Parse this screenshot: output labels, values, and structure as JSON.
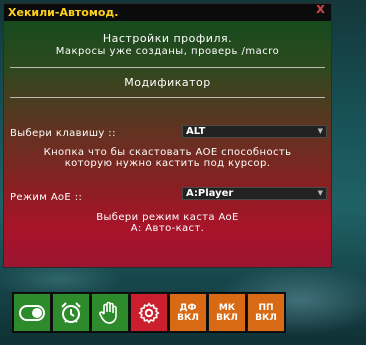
{
  "window": {
    "title": "Хекили-Автомод.",
    "close_glyph": "x"
  },
  "header": {
    "line1": "Настройки профиля.",
    "line2": "Макросы уже созданы, проверь /macro"
  },
  "section": {
    "title": "Модификатор"
  },
  "key_setting": {
    "label": "Выбери клавишу ::",
    "value": "ALT",
    "desc_line1": "Кнопка что бы скастовать AOE способность",
    "desc_line2": "которую нужно кастить под курсор."
  },
  "aoe_setting": {
    "label": "Режим AoE ::",
    "value": "A:Player",
    "desc_line1": "Выбери режим каста AoE",
    "desc_line2": "А: Авто-каст."
  },
  "toolbar": {
    "buttons": [
      {
        "icon": "toggle-icon",
        "color": "#2e8b2c"
      },
      {
        "icon": "alarm-clock-icon",
        "color": "#2e8b2c"
      },
      {
        "icon": "hand-icon",
        "color": "#2e8b2c"
      },
      {
        "icon": "gear-icon",
        "color": "#cc1f2e"
      },
      {
        "line1": "ДФ",
        "line2": "ВКЛ",
        "color": "#d96a15"
      },
      {
        "line1": "МК",
        "line2": "ВКЛ",
        "color": "#d96a15"
      },
      {
        "line1": "ПП",
        "line2": "ВКЛ",
        "color": "#d96a15"
      }
    ]
  }
}
